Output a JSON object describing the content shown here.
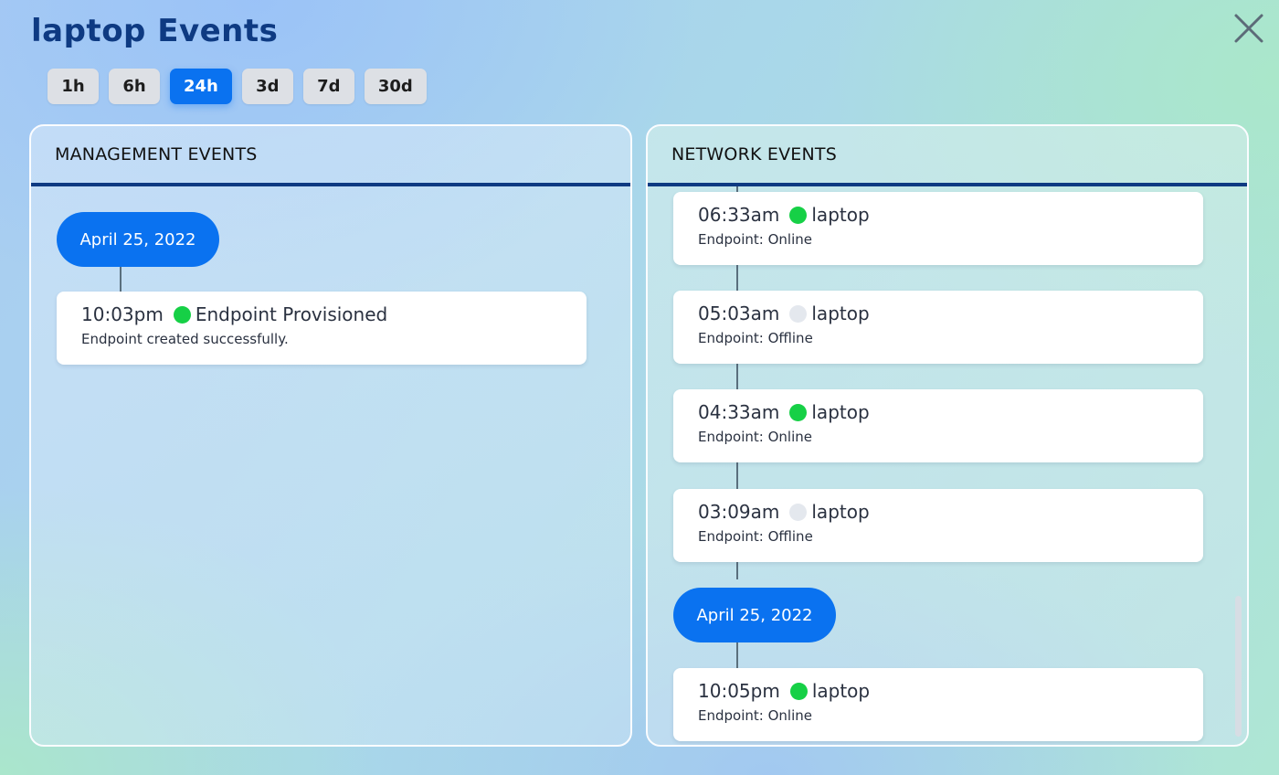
{
  "title": "laptop Events",
  "range_tabs": [
    {
      "label": "1h",
      "active": false
    },
    {
      "label": "6h",
      "active": false
    },
    {
      "label": "24h",
      "active": true
    },
    {
      "label": "3d",
      "active": false
    },
    {
      "label": "7d",
      "active": false
    },
    {
      "label": "30d",
      "active": false
    }
  ],
  "management": {
    "header": "MANAGEMENT EVENTS",
    "date": "April 25, 2022",
    "events": [
      {
        "time": "10:03pm",
        "status": "online",
        "name": "Endpoint Provisioned",
        "desc": "Endpoint created successfully."
      }
    ]
  },
  "network": {
    "header": "NETWORK EVENTS",
    "events": [
      {
        "time": "06:33am",
        "status": "online",
        "name": "laptop",
        "desc": "Endpoint: Online"
      },
      {
        "time": "05:03am",
        "status": "offline",
        "name": "laptop",
        "desc": "Endpoint: Offline"
      },
      {
        "time": "04:33am",
        "status": "online",
        "name": "laptop",
        "desc": "Endpoint: Online"
      },
      {
        "time": "03:09am",
        "status": "offline",
        "name": "laptop",
        "desc": "Endpoint: Offline"
      }
    ],
    "date": "April 25, 2022",
    "events2": [
      {
        "time": "10:05pm",
        "status": "online",
        "name": "laptop",
        "desc": "Endpoint: Online"
      }
    ]
  },
  "colors": {
    "accent": "#0a72f0",
    "title": "#0e3a82",
    "online": "#16d046",
    "offline": "#e4e8ee"
  }
}
